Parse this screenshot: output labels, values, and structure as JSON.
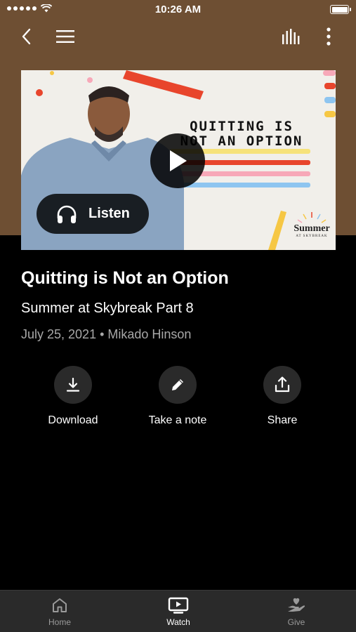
{
  "status_bar": {
    "time": "10:26 AM"
  },
  "header": {
    "back_icon": "chevron-left-icon",
    "menu_icon": "hamburger-icon",
    "levels_icon": "equalizer-icon",
    "more_icon": "more-vertical-icon"
  },
  "video": {
    "thumbnail_title": "QUITTING IS NOT AN OPTION",
    "thumbnail_logo": "Summer",
    "thumbnail_logo_sub": "AT SKYBREAK",
    "play_icon": "play-icon",
    "listen_label": "Listen",
    "listen_icon": "headphones-icon"
  },
  "sermon": {
    "title": "Quitting is Not an Option",
    "series": "Summer at Skybreak Part 8",
    "meta": "July 25, 2021 • Mikado Hinson"
  },
  "actions": [
    {
      "label": "Download",
      "icon": "download-icon"
    },
    {
      "label": "Take a note",
      "icon": "pencil-icon"
    },
    {
      "label": "Share",
      "icon": "share-icon"
    }
  ],
  "tabs": [
    {
      "label": "Home",
      "icon": "home-icon",
      "active": false
    },
    {
      "label": "Watch",
      "icon": "tv-play-icon",
      "active": true
    },
    {
      "label": "Give",
      "icon": "hand-heart-icon",
      "active": false
    }
  ],
  "colors": {
    "hero_brown": "#6e4f33",
    "background": "#000000",
    "tabbar": "#2a2a2a",
    "active_tab": "#ffffff",
    "inactive_tab": "#9a9a9a"
  }
}
